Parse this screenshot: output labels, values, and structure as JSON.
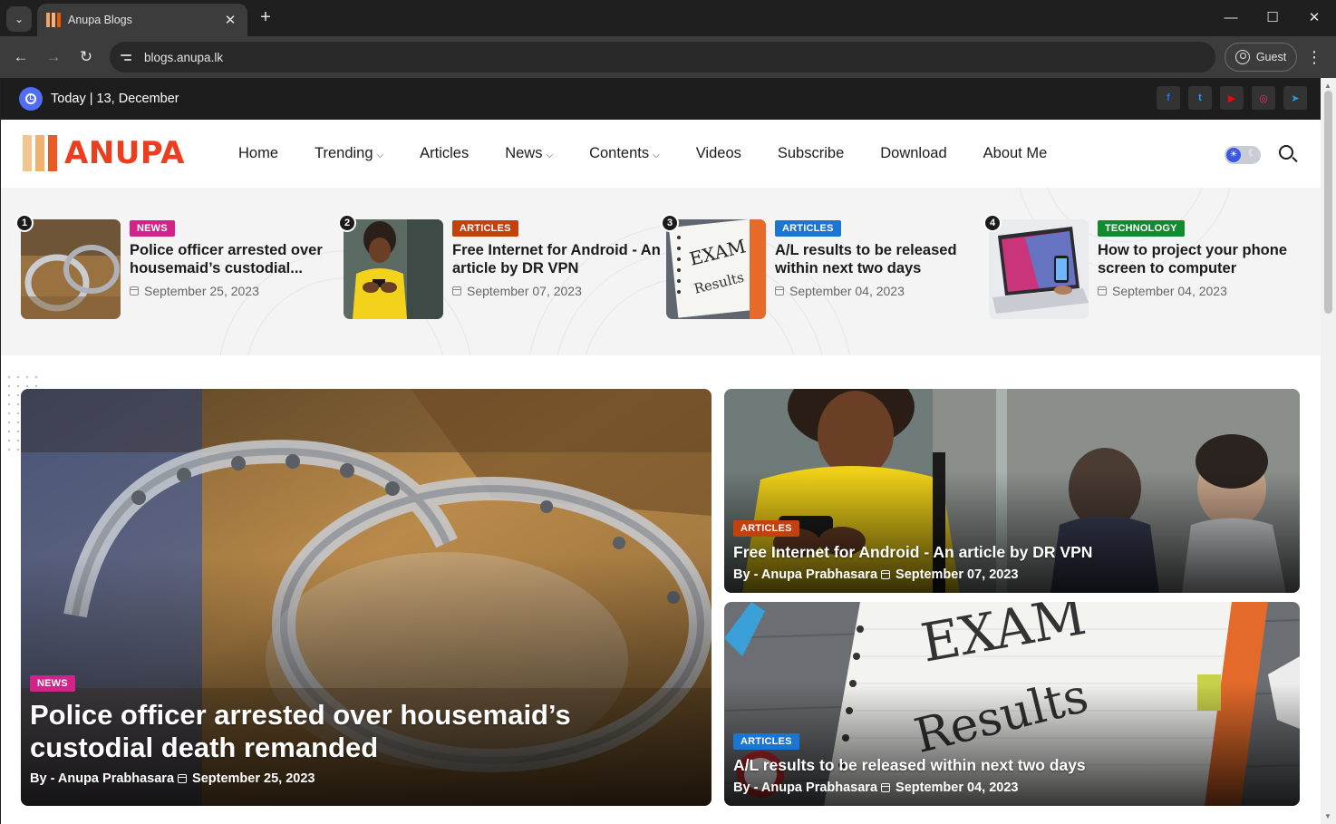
{
  "browser": {
    "tab_title": "Anupa Blogs",
    "url": "blogs.anupa.lk",
    "profile_label": "Guest"
  },
  "topbar": {
    "today_label": "Today",
    "date": "13, December",
    "social": [
      {
        "name": "facebook-icon",
        "glyph": "f",
        "color": "#1877f2"
      },
      {
        "name": "twitter-icon",
        "glyph": "t",
        "color": "#1da1f2"
      },
      {
        "name": "youtube-icon",
        "glyph": "▶",
        "color": "#ff0000"
      },
      {
        "name": "instagram-icon",
        "glyph": "◎",
        "color": "#e1306c"
      },
      {
        "name": "telegram-icon",
        "glyph": "➤",
        "color": "#2aa2de"
      }
    ]
  },
  "header": {
    "logo_text": "ANUPA",
    "nav": [
      {
        "label": "Home",
        "dropdown": false
      },
      {
        "label": "Trending",
        "dropdown": true
      },
      {
        "label": "Articles",
        "dropdown": false
      },
      {
        "label": "News",
        "dropdown": true
      },
      {
        "label": "Contents",
        "dropdown": true
      },
      {
        "label": "Videos",
        "dropdown": false
      },
      {
        "label": "Subscribe",
        "dropdown": false
      },
      {
        "label": "Download",
        "dropdown": false
      },
      {
        "label": "About Me",
        "dropdown": false
      }
    ]
  },
  "trending": [
    {
      "num": "1",
      "category": "NEWS",
      "title": "Police officer arrested over housemaid’s custodial...",
      "date": "September 25, 2023"
    },
    {
      "num": "2",
      "category": "ARTICLES",
      "title": "Free Internet for Android - An article by DR VPN",
      "date": "September 07, 2023"
    },
    {
      "num": "3",
      "category": "ARTICLES",
      "title": "A/L results to be released within next two days",
      "date": "September 04, 2023"
    },
    {
      "num": "4",
      "category": "TECHNOLOGY",
      "title": "How to project your phone screen to computer",
      "date": "September 04, 2023"
    }
  ],
  "featured": {
    "main": {
      "category": "NEWS",
      "title": "Police officer arrested over housemaid’s custodial death remanded",
      "author": "By - Anupa Prabhasara",
      "date": "September 25, 2023"
    },
    "side": [
      {
        "category": "ARTICLES",
        "title": "Free Internet for Android - An article by DR VPN",
        "author": "By - Anupa Prabhasara",
        "date": "September 07, 2023"
      },
      {
        "category": "ARTICLES",
        "title": "A/L results to be released within next two days",
        "author": "By - Anupa Prabhasara",
        "date": "September 04, 2023"
      }
    ]
  },
  "illustrations": {
    "handcuffs": "Exam",
    "exam_word": "EXAM",
    "results_word": "Results"
  }
}
